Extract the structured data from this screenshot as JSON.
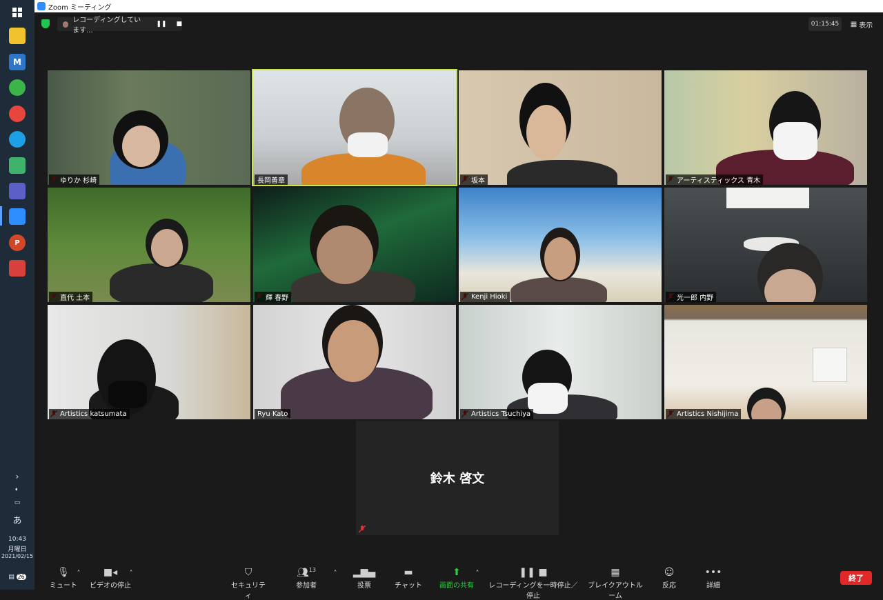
{
  "window": {
    "title": "Zoom ミーティング"
  },
  "recording": {
    "text": "レコーディングしています...",
    "pause": "❚❚",
    "stop": "■"
  },
  "timer": "01:15:45",
  "view_label": "表示",
  "participants_tiles": [
    {
      "name": "ゆりか 杉崎"
    },
    {
      "name": "長岡善章"
    },
    {
      "name": "坂本"
    },
    {
      "name": "アーティスティックス 青木"
    },
    {
      "name": "直代 土本"
    },
    {
      "name": "輝 春野"
    },
    {
      "name": "Kenji Hioki"
    },
    {
      "name": "光一郎 内野"
    },
    {
      "name": "Artistics katsumata"
    },
    {
      "name": "Ryu Kato"
    },
    {
      "name": "Artistics Tsuchiya"
    },
    {
      "name": "Artistics Nishijima"
    }
  ],
  "name_only_tile": "鈴木 啓文",
  "toolbar": {
    "mute": "ミュート",
    "video": "ビデオの停止",
    "security": "セキュリティ",
    "participants": "参加者",
    "participant_count": "13",
    "poll": "投票",
    "chat": "チャット",
    "share": "画面の共有",
    "record": "レコーディングを一時停止／停止",
    "breakout": "ブレイクアウトルーム",
    "reactions": "反応",
    "more": "詳細",
    "end": "終了"
  },
  "system": {
    "ime": "あ",
    "time": "10:43",
    "day": "月曜日",
    "date": "2021/02/15",
    "notifications": "26"
  },
  "colors": {
    "accent": "#2d8cff",
    "share": "#2ecc40",
    "end": "#e02828",
    "active_speaker": "#c8e64c"
  }
}
